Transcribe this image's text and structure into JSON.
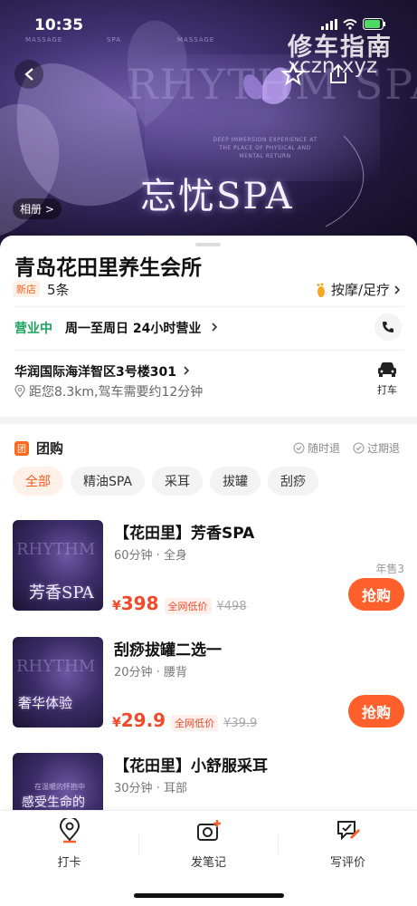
{
  "status_bar": {
    "time": "10:35"
  },
  "watermark": {
    "line1": "修车指南",
    "line2": "xczn.xyz"
  },
  "hero": {
    "brand_text": "RHYTHM SPA",
    "top_labels": [
      "MASSAGE",
      "SPA",
      "MASSAGE"
    ],
    "motto": "DEEP IMMERSION EXPERIENCE AT THE PLACE OF PHYSICAL AND MENTAL RETURN",
    "title": "忘忧SPA",
    "album_label": "相册 >"
  },
  "store": {
    "name": "青岛花田里养生会所",
    "new_tag": "新店",
    "review_count": "5条",
    "category": "按摩/足疗",
    "open_status": "营业中",
    "open_hours": "周一至周日 24小时营业",
    "address": "华润国际海洋智区3号楼301",
    "distance": "距您8.3km,驾车需要约12分钟",
    "taxi_label": "打车"
  },
  "group_buy": {
    "icon_text": "团",
    "title": "团购",
    "policies": [
      "随时退",
      "过期退"
    ],
    "chips": [
      "全部",
      "精油SPA",
      "采耳",
      "拔罐",
      "刮痧"
    ],
    "deals": [
      {
        "name": "【花田里】芳香SPA",
        "sub": "60分钟 · 全身",
        "thumb_text": "芳香SPA",
        "thumb_brand": "RHYTHM",
        "price": "398",
        "tag": "全网低价",
        "orig": "¥498",
        "sales": "年售3",
        "buy": "抢购"
      },
      {
        "name": "刮痧拔罐二选一",
        "sub": "20分钟 · 腰背",
        "thumb_text": "奢华体验",
        "thumb_brand": "RHYTHM",
        "price": "29.9",
        "tag": "全网低价",
        "orig": "¥39.9",
        "sales": "",
        "buy": "抢购"
      },
      {
        "name": "【花田里】小舒服采耳",
        "sub": "30分钟 · 耳部",
        "thumb_text": "感受生命的",
        "thumb_brand": "在温暖的怀抱中",
        "price": "",
        "tag": "",
        "orig": "",
        "sales": "",
        "buy": ""
      }
    ]
  },
  "bottom_tabs": [
    {
      "label": "打卡",
      "icon": "location-pin-icon"
    },
    {
      "label": "发笔记",
      "icon": "camera-plus-icon"
    },
    {
      "label": "写评价",
      "icon": "edit-review-icon"
    }
  ],
  "colors": {
    "accent": "#ff5f2b",
    "price": "#f14a2a",
    "open": "#1aa35b",
    "hero_dark": "#1e1638"
  }
}
